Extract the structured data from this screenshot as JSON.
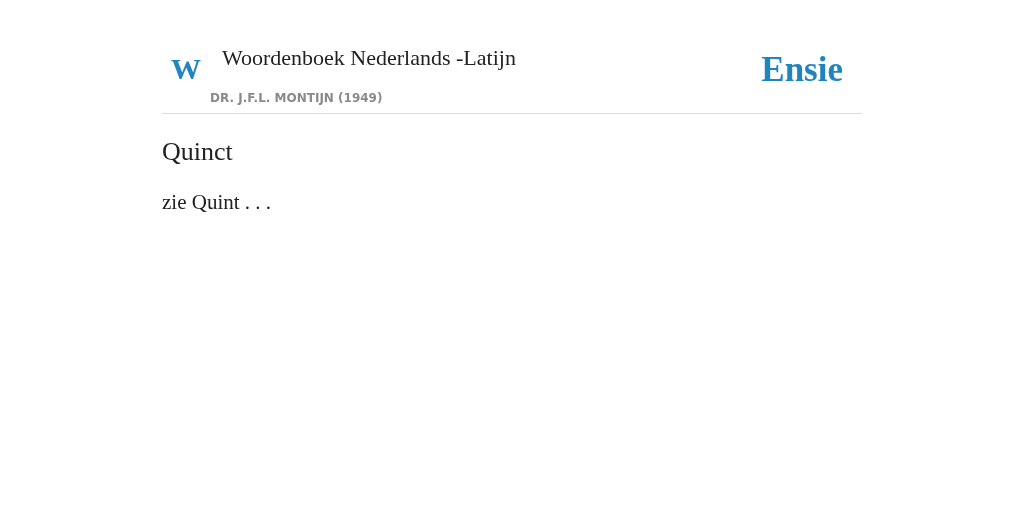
{
  "header": {
    "logo_letter": "W",
    "title": "Woordenboek Nederlands -Latijn",
    "subtitle": "DR. J.F.L. MONTIJN (1949)",
    "brand": "Ensie"
  },
  "entry": {
    "term": "Quinct",
    "definition": "zie Quint . . ."
  }
}
